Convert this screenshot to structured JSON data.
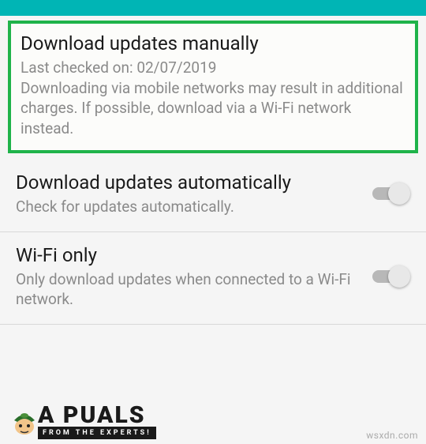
{
  "settings": {
    "manual": {
      "title": "Download updates manually",
      "last_checked_label": "Last checked on: 02/07/2019",
      "description": "Downloading via mobile networks may result in additional charges. If possible, download via a Wi-Fi network instead."
    },
    "auto": {
      "title": "Download updates automatically",
      "description": "Check for updates automatically.",
      "toggle_on": false
    },
    "wifi": {
      "title": "Wi-Fi only",
      "description": "Only download updates when connected to a Wi-Fi network.",
      "toggle_on": false
    }
  },
  "branding": {
    "logo_text": "A PUALS",
    "tagline": "FROM THE EXPERTS!"
  },
  "watermark": "wsxdn.com"
}
